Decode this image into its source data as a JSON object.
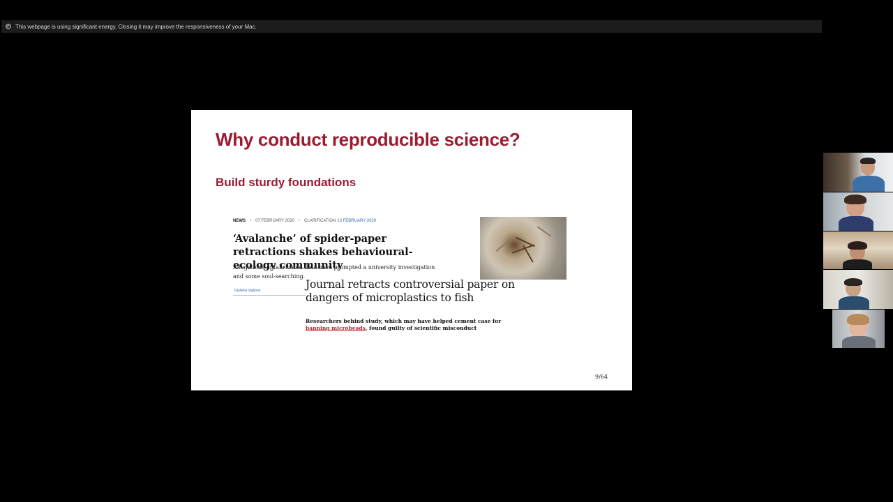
{
  "energy_banner": {
    "text": "This webpage is using significant energy. Closing it may improve the responsiveness of your Mac."
  },
  "slide": {
    "title": "Why conduct reproducible science?",
    "subtitle": "Build sturdy foundations",
    "page_number": "9/64",
    "news1": {
      "tag": "NEWS",
      "date": "07 FEBRUARY 2020",
      "clarification_label": "CLARIFICATION",
      "clarification_date": "13 FEBRUARY 2020",
      "headline": "‘Avalanche’ of spider-paper retractions shakes behavioural-ecology community",
      "standfirst": "Allegations of fabricated data have prompted a university investigation and some soul-searching.",
      "author": "Giuliana Viglione"
    },
    "news2": {
      "headline": "Journal retracts controversial paper on dangers of microplastics to fish",
      "standfirst_pre": "Researchers behind study, which may have helped cement case for",
      "standfirst_link": "banning microbeads",
      "standfirst_post": ", found guilty of scientific misconduct"
    }
  },
  "colors": {
    "slide_accent": "#9b1b30",
    "link_red": "#b3232e",
    "link_blue": "#2a6db0"
  }
}
